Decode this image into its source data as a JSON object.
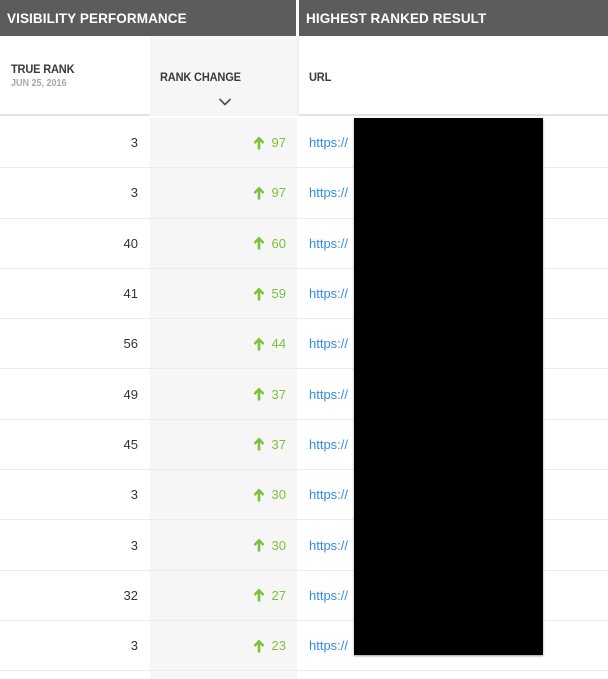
{
  "group_headers": {
    "visibility": "VISIBILITY PERFORMANCE",
    "result": "HIGHEST RANKED RESULT"
  },
  "columns": {
    "true_rank": {
      "label": "TRUE RANK",
      "date": "JUN 25, 2016"
    },
    "rank_change": {
      "label": "RANK CHANGE",
      "sort_icon": "chevron-down-icon"
    },
    "url": {
      "label": "URL"
    }
  },
  "colors": {
    "header_bg": "#5c5c5c",
    "rank_up": "#7dc13a",
    "link": "#2f8de4",
    "redaction": "#000000"
  },
  "rows": [
    {
      "true_rank": "3",
      "direction": "up",
      "change": "97",
      "url": "https://"
    },
    {
      "true_rank": "3",
      "direction": "up",
      "change": "97",
      "url": "https://"
    },
    {
      "true_rank": "40",
      "direction": "up",
      "change": "60",
      "url": "https://"
    },
    {
      "true_rank": "41",
      "direction": "up",
      "change": "59",
      "url": "https://"
    },
    {
      "true_rank": "56",
      "direction": "up",
      "change": "44",
      "url": "https://"
    },
    {
      "true_rank": "49",
      "direction": "up",
      "change": "37",
      "url": "https://"
    },
    {
      "true_rank": "45",
      "direction": "up",
      "change": "37",
      "url": "https://"
    },
    {
      "true_rank": "3",
      "direction": "up",
      "change": "30",
      "url": "https://"
    },
    {
      "true_rank": "3",
      "direction": "up",
      "change": "30",
      "url": "https://"
    },
    {
      "true_rank": "32",
      "direction": "up",
      "change": "27",
      "url": "https://"
    },
    {
      "true_rank": "3",
      "direction": "up",
      "change": "23",
      "url": "https://"
    }
  ]
}
